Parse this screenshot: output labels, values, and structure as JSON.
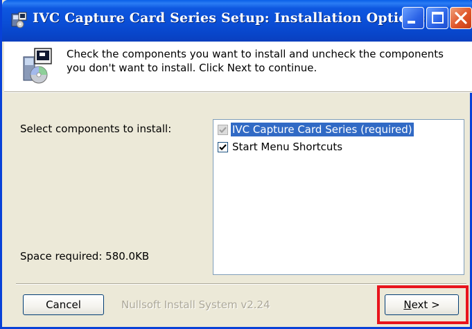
{
  "window": {
    "title": "IVC Capture Card Series Setup: Installation Options",
    "accent_color": "#0a4ed6",
    "icons": [
      "installer-icon",
      "minimize-icon",
      "maximize-icon",
      "close-icon"
    ]
  },
  "header": {
    "line1": "Check the components you want to install and uncheck the components",
    "line2": "you don't want to install. Click Next to continue.",
    "icon": "installer-box-icon"
  },
  "components": {
    "label": "Select components to install:",
    "items": [
      {
        "label": "IVC Capture Card Series (required)",
        "checked": true,
        "disabled": true,
        "selected": true
      },
      {
        "label": "Start Menu Shortcuts",
        "checked": true,
        "disabled": false,
        "selected": false
      }
    ]
  },
  "space": {
    "label": "Space required: 580.0KB"
  },
  "footer": {
    "cancel_label": "Cancel",
    "brand_text": "Nullsoft Install System v2.24",
    "next_mnemonic": "N",
    "next_rest": "ext >",
    "highlight_color": "#e8141c"
  }
}
